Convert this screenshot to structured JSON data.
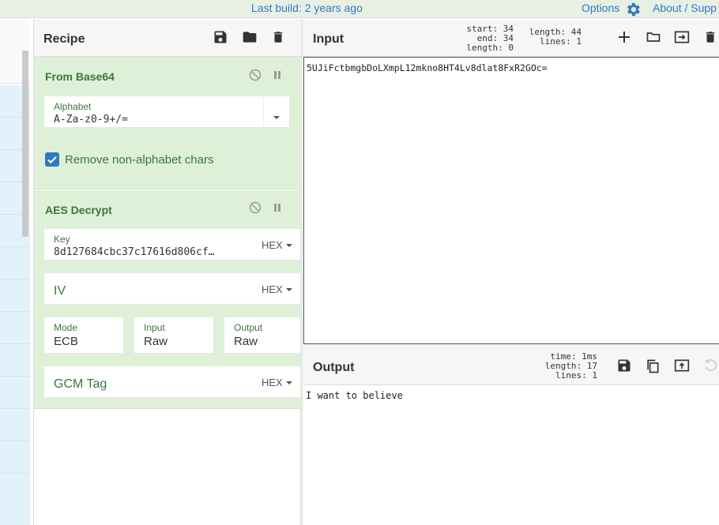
{
  "topbar": {
    "build_text": "Last build: 2 years ago",
    "options_label": "Options",
    "about_label": "About / Supp",
    "accent_color": "#2f78c4"
  },
  "recipe": {
    "title": "Recipe",
    "icons": [
      "save-icon",
      "folder-icon",
      "trash-icon"
    ],
    "operations": [
      {
        "name": "From Base64",
        "alphabet_label": "Alphabet",
        "alphabet_value": "A-Za-z0-9+/=",
        "remove_nonalpha_label": "Remove non-alphabet chars",
        "remove_nonalpha_checked": true
      },
      {
        "name": "AES Decrypt",
        "key_label": "Key",
        "key_value": "8d127684cbc37c17616d806cf…",
        "key_format": "HEX",
        "iv_placeholder": "IV",
        "iv_format": "HEX",
        "mode_label": "Mode",
        "mode_value": "ECB",
        "input_label": "Input",
        "input_value": "Raw",
        "output_label": "Output",
        "output_value": "Raw",
        "gcm_placeholder": "GCM Tag",
        "gcm_format": "HEX"
      }
    ]
  },
  "input": {
    "title": "Input",
    "stats_left": [
      "start: 34",
      "end: 34",
      "length: 0"
    ],
    "stats_right": [
      "length: 44",
      "lines: 1"
    ],
    "text": "5UJiFctbmgbDoLXmpL12mkno8HT4Lv8dlat8FxR2GOc="
  },
  "output": {
    "title": "Output",
    "stats": [
      "time: 1ms",
      "length: 17",
      "lines: 1"
    ],
    "text": "I want to believe"
  }
}
